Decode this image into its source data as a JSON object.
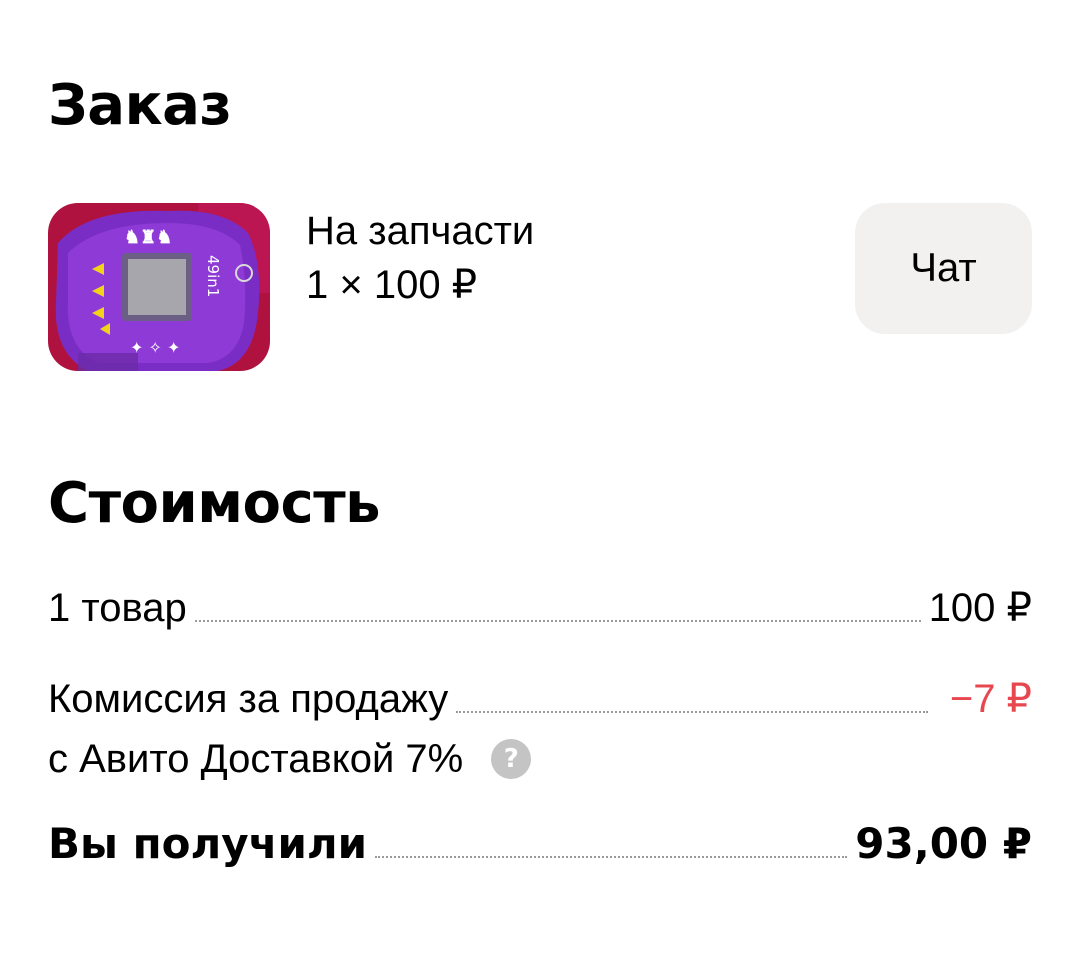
{
  "order": {
    "title": "Заказ",
    "item": {
      "name": "На запчасти",
      "quantity_price": "1 × 100 ₽",
      "thumbnail_printed_text": "49in1"
    },
    "chat_label": "Чат"
  },
  "cost": {
    "title": "Стоимость",
    "goods_label": "1 товар",
    "goods_value": "100 ₽",
    "fee_label_line1": "Комиссия за продажу",
    "fee_label_line2": "с Авито Доставкой 7%",
    "fee_value": "−7 ₽",
    "help_icon": "question-circle-icon",
    "help_glyph": "?",
    "total_label": "Вы получили",
    "total_value": "93,00 ₽"
  },
  "colors": {
    "background": "#ffffff",
    "text": "#000000",
    "chat_button_bg": "#f2f1f0",
    "negative": "#e8474f",
    "help_icon_bg": "#c4c4c4"
  }
}
